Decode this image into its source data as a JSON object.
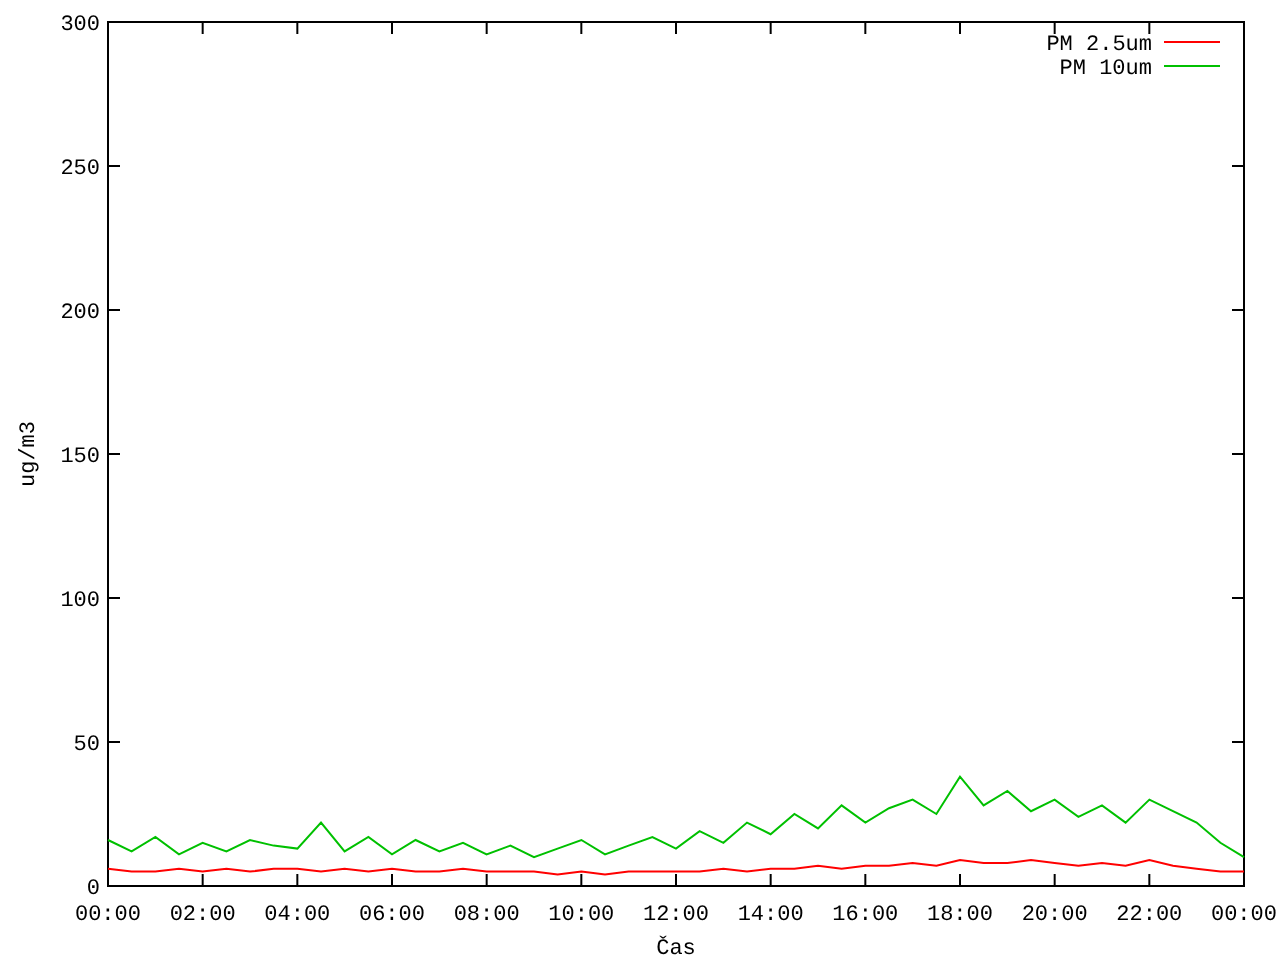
{
  "chart_data": {
    "type": "line",
    "legend": true,
    "xlabel": "Čas",
    "ylabel": "ug/m3",
    "xlim": [
      0,
      24
    ],
    "ylim": [
      0,
      300
    ],
    "xticks": [
      {
        "value": 0,
        "label": "00:00"
      },
      {
        "value": 2,
        "label": "02:00"
      },
      {
        "value": 4,
        "label": "04:00"
      },
      {
        "value": 6,
        "label": "06:00"
      },
      {
        "value": 8,
        "label": "08:00"
      },
      {
        "value": 10,
        "label": "10:00"
      },
      {
        "value": 12,
        "label": "12:00"
      },
      {
        "value": 14,
        "label": "14:00"
      },
      {
        "value": 16,
        "label": "16:00"
      },
      {
        "value": 18,
        "label": "18:00"
      },
      {
        "value": 20,
        "label": "20:00"
      },
      {
        "value": 22,
        "label": "22:00"
      },
      {
        "value": 24,
        "label": "00:00"
      }
    ],
    "yticks": [
      0,
      50,
      100,
      150,
      200,
      250,
      300
    ],
    "x": [
      0,
      0.5,
      1,
      1.5,
      2,
      2.5,
      3,
      3.5,
      4,
      4.5,
      5,
      5.5,
      6,
      6.5,
      7,
      7.5,
      8,
      8.5,
      9,
      9.5,
      10,
      10.5,
      11,
      11.5,
      12,
      12.5,
      13,
      13.5,
      14,
      14.5,
      15,
      15.5,
      16,
      16.5,
      17,
      17.5,
      18,
      18.5,
      19,
      19.5,
      20,
      20.5,
      21,
      21.5,
      22,
      22.5,
      23,
      23.5,
      24
    ],
    "series": [
      {
        "name": "PM 2.5um",
        "color": "#ff0000",
        "values": [
          6,
          5,
          5,
          6,
          5,
          6,
          5,
          6,
          6,
          5,
          6,
          5,
          6,
          5,
          5,
          6,
          5,
          5,
          5,
          4,
          5,
          4,
          5,
          5,
          5,
          5,
          6,
          5,
          6,
          6,
          7,
          6,
          7,
          7,
          8,
          7,
          9,
          8,
          8,
          9,
          8,
          7,
          8,
          7,
          9,
          7,
          6,
          5,
          5
        ]
      },
      {
        "name": "PM 10um",
        "color": "#00c000",
        "values": [
          16,
          12,
          17,
          11,
          15,
          12,
          16,
          14,
          13,
          22,
          12,
          17,
          11,
          16,
          12,
          15,
          11,
          14,
          10,
          13,
          16,
          11,
          14,
          17,
          13,
          19,
          15,
          22,
          18,
          25,
          20,
          28,
          22,
          27,
          30,
          25,
          38,
          28,
          33,
          26,
          30,
          24,
          28,
          22,
          30,
          26,
          22,
          15,
          10
        ]
      }
    ]
  }
}
